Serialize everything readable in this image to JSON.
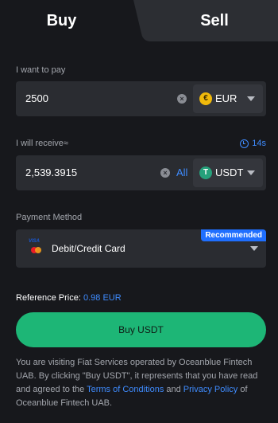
{
  "tabs": {
    "buy": "Buy",
    "sell": "Sell"
  },
  "pay": {
    "label": "I want to pay",
    "amount": "2500",
    "currency": "EUR",
    "currency_icon_glyph": "€"
  },
  "receive": {
    "label": "I will receive≈",
    "timer": "14s",
    "amount": "2,539.3915",
    "all_label": "All",
    "currency": "USDT",
    "currency_icon_glyph": "T"
  },
  "payment": {
    "label": "Payment Method",
    "method": "Debit/Credit Card",
    "badge": "Recommended",
    "card_brand_text": "VISA"
  },
  "reference": {
    "label": "Reference Price:",
    "value": "0.98 EUR"
  },
  "buy_button": "Buy USDT",
  "disclaimer": {
    "part1": "You are visiting Fiat Services operated by Oceanblue Fintech UAB. By clicking \"Buy USDT\", it represents that you have read and agreed to the ",
    "terms_link": "Terms of Conditions",
    "and": " and ",
    "privacy_link": "Privacy Policy",
    "part2": " of Oceanblue Fintech UAB."
  },
  "colors": {
    "background": "#17181c",
    "field": "#2a2c31",
    "accent_blue": "#3f8cff",
    "buy_green": "#1db676",
    "eur_gold": "#f0b90b",
    "usdt_green": "#26a17b"
  },
  "icons": {
    "clear": "clear-circle-icon",
    "timer": "clock-icon",
    "dropdown": "caret-down-icon",
    "card": "visa-mastercard-icon"
  }
}
